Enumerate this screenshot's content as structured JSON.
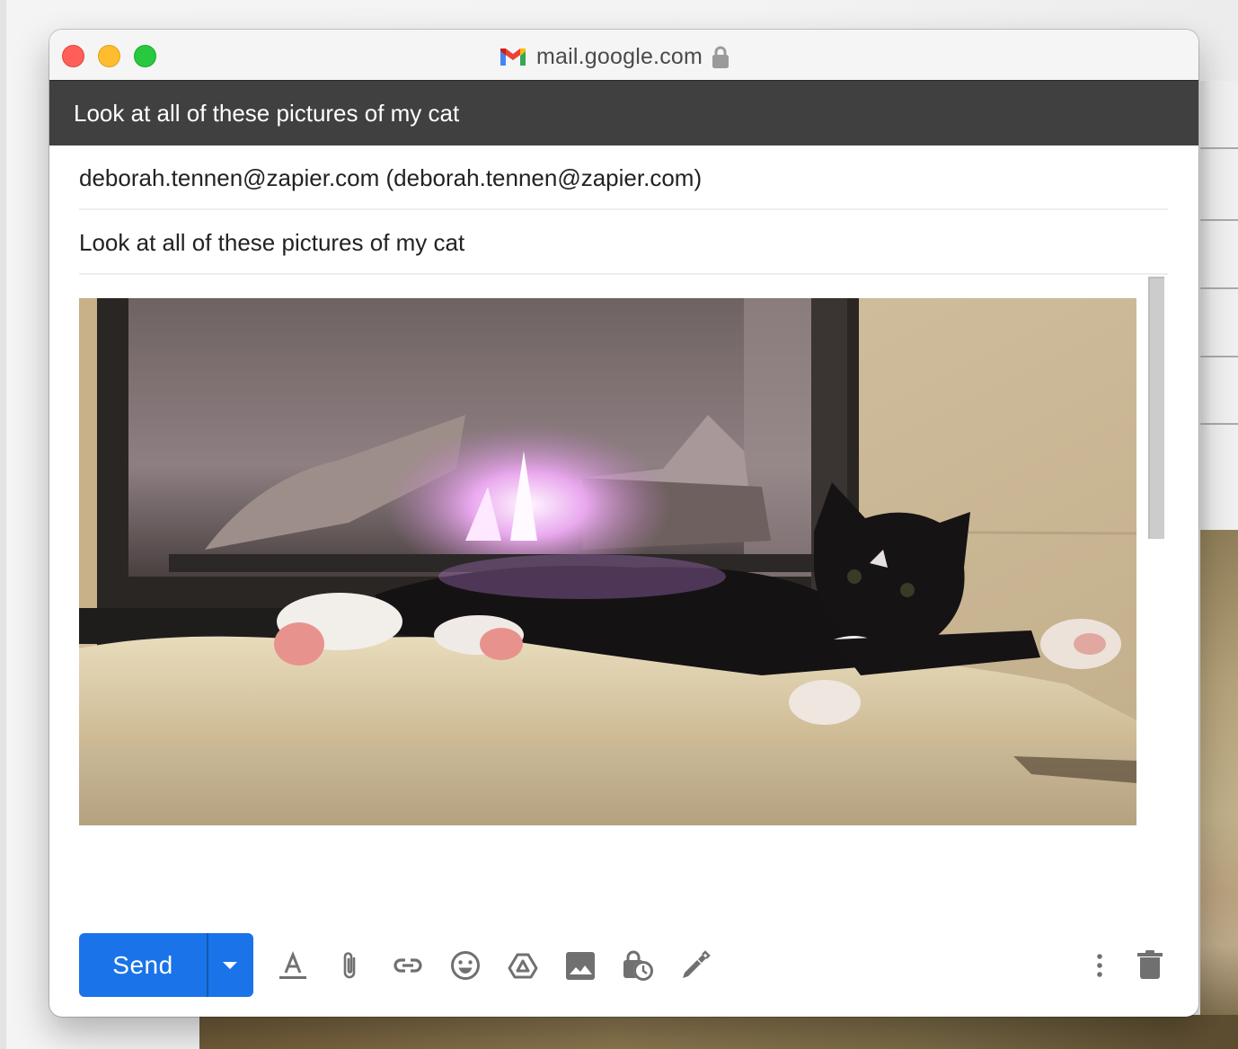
{
  "browser": {
    "url": "mail.google.com",
    "favicon": "gmail-m-logo",
    "secure_icon": "lock-icon"
  },
  "compose": {
    "header_title": "Look at all of these pictures of my cat",
    "to_value": "deborah.tennen@zapier.com (deborah.tennen@zapier.com)",
    "subject_value": "Look at all of these pictures of my cat",
    "body_image": {
      "description": "Photo of a black and white tuxedo cat lying on a sheepskin rug in front of a lit fireplace",
      "icon": "inline-image"
    }
  },
  "toolbar": {
    "send_label": "Send",
    "more_send_options_icon": "caret-down-icon",
    "icons": [
      {
        "name": "formatting-options",
        "icon": "text-format-icon"
      },
      {
        "name": "attach-files",
        "icon": "paperclip-icon"
      },
      {
        "name": "insert-link",
        "icon": "link-icon"
      },
      {
        "name": "insert-emoji",
        "icon": "emoji-icon"
      },
      {
        "name": "insert-from-drive",
        "icon": "drive-icon"
      },
      {
        "name": "insert-photo",
        "icon": "photo-icon"
      },
      {
        "name": "confidential-mode",
        "icon": "lock-clock-icon"
      },
      {
        "name": "insert-signature",
        "icon": "pen-icon"
      }
    ],
    "more_options_icon": "more-vert-icon",
    "discard_icon": "trash-icon"
  },
  "colors": {
    "send_button": "#1a73e8",
    "header_bar": "#404040",
    "icon_gray": "#707070"
  }
}
